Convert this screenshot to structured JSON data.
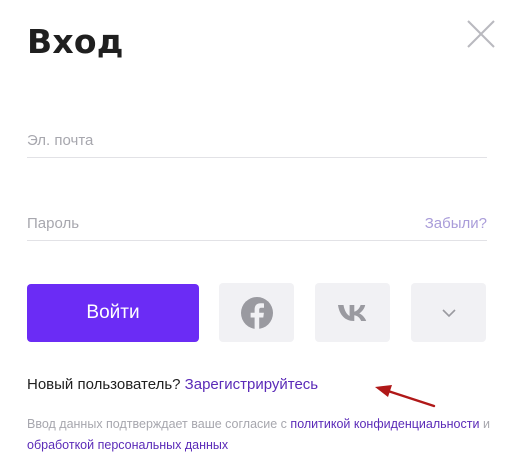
{
  "header": {
    "title": "Вход",
    "close_icon": "close-icon"
  },
  "form": {
    "email": {
      "placeholder": "Эл. почта",
      "value": ""
    },
    "password": {
      "placeholder": "Пароль",
      "value": "",
      "forgot_label": "Забыли?"
    },
    "login_label": "Войти"
  },
  "social": {
    "buttons": [
      {
        "icon": "facebook-icon"
      },
      {
        "icon": "vk-icon"
      },
      {
        "icon": "chevron-down-icon"
      }
    ]
  },
  "register": {
    "prompt": "Новый пользователь?",
    "link_label": "Зарегистрируйтесь"
  },
  "consent": {
    "prefix": "Ввод данных подтверждает ваше согласие с",
    "policy_link": "политикой конфиденциальности",
    "conjunction": "и",
    "processing_link": "обработкой персональных данных"
  },
  "colors": {
    "accent": "#6b2cf5",
    "link": "#5b2bb8",
    "muted_link": "#a99cd9",
    "annotation_arrow": "#b01818",
    "social_bg": "#f1f1f4"
  }
}
